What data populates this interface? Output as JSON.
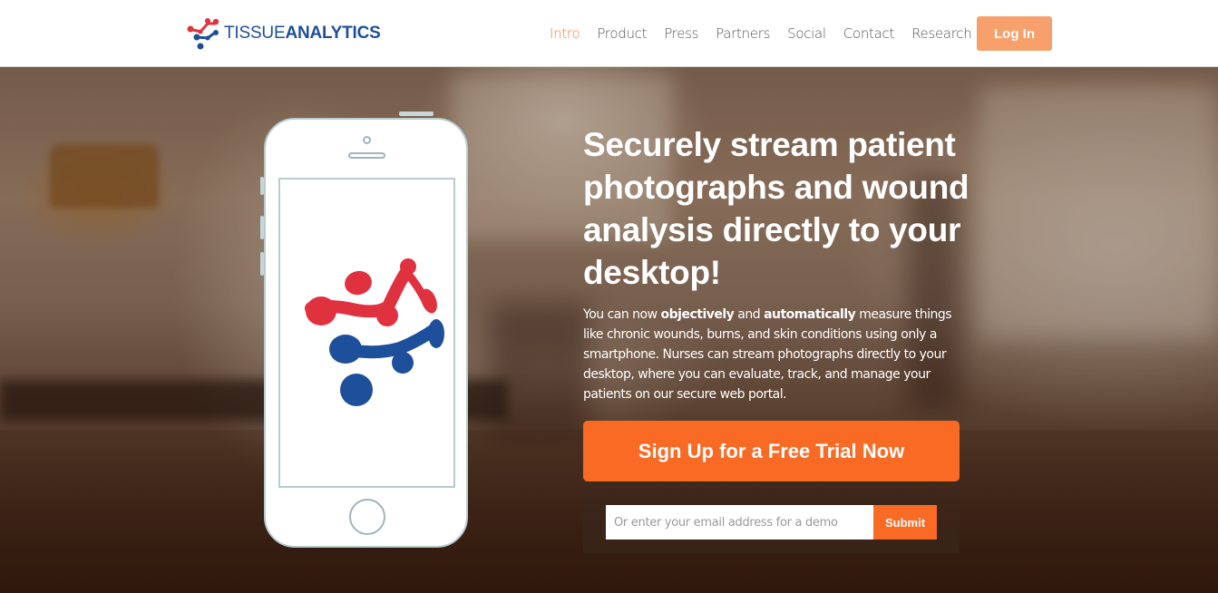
{
  "brand": {
    "name_part1": "TISSUE",
    "name_part2": "ANALYTICS",
    "logo_icon": "tissue-analytics-molecule-icon",
    "colors": {
      "red": "#e0313f",
      "blue": "#1d4f9b",
      "accent": "#f96a25"
    }
  },
  "nav": {
    "items": [
      {
        "label": "Intro",
        "active": true
      },
      {
        "label": "Product",
        "active": false
      },
      {
        "label": "Press",
        "active": false
      },
      {
        "label": "Partners",
        "active": false
      },
      {
        "label": "Social",
        "active": false
      },
      {
        "label": "Contact",
        "active": false
      },
      {
        "label": "Research",
        "active": false
      }
    ],
    "login_label": "Log In"
  },
  "hero": {
    "headline": "Securely stream patient photographs and wound analysis directly to your desktop!",
    "desc_1": "You can now ",
    "desc_bold_1": "objectively",
    "desc_2": " and ",
    "desc_bold_2": "automatically",
    "desc_3": " measure things like chronic wounds, burns, and skin conditions using only a smartphone. Nurses can stream photographs directly to your desktop, where you can evaluate, track, and manage your patients on our secure web portal.",
    "signup_label": "Sign Up for a Free Trial Now",
    "email_placeholder": "Or enter your email address for a demo",
    "submit_label": "Submit"
  }
}
